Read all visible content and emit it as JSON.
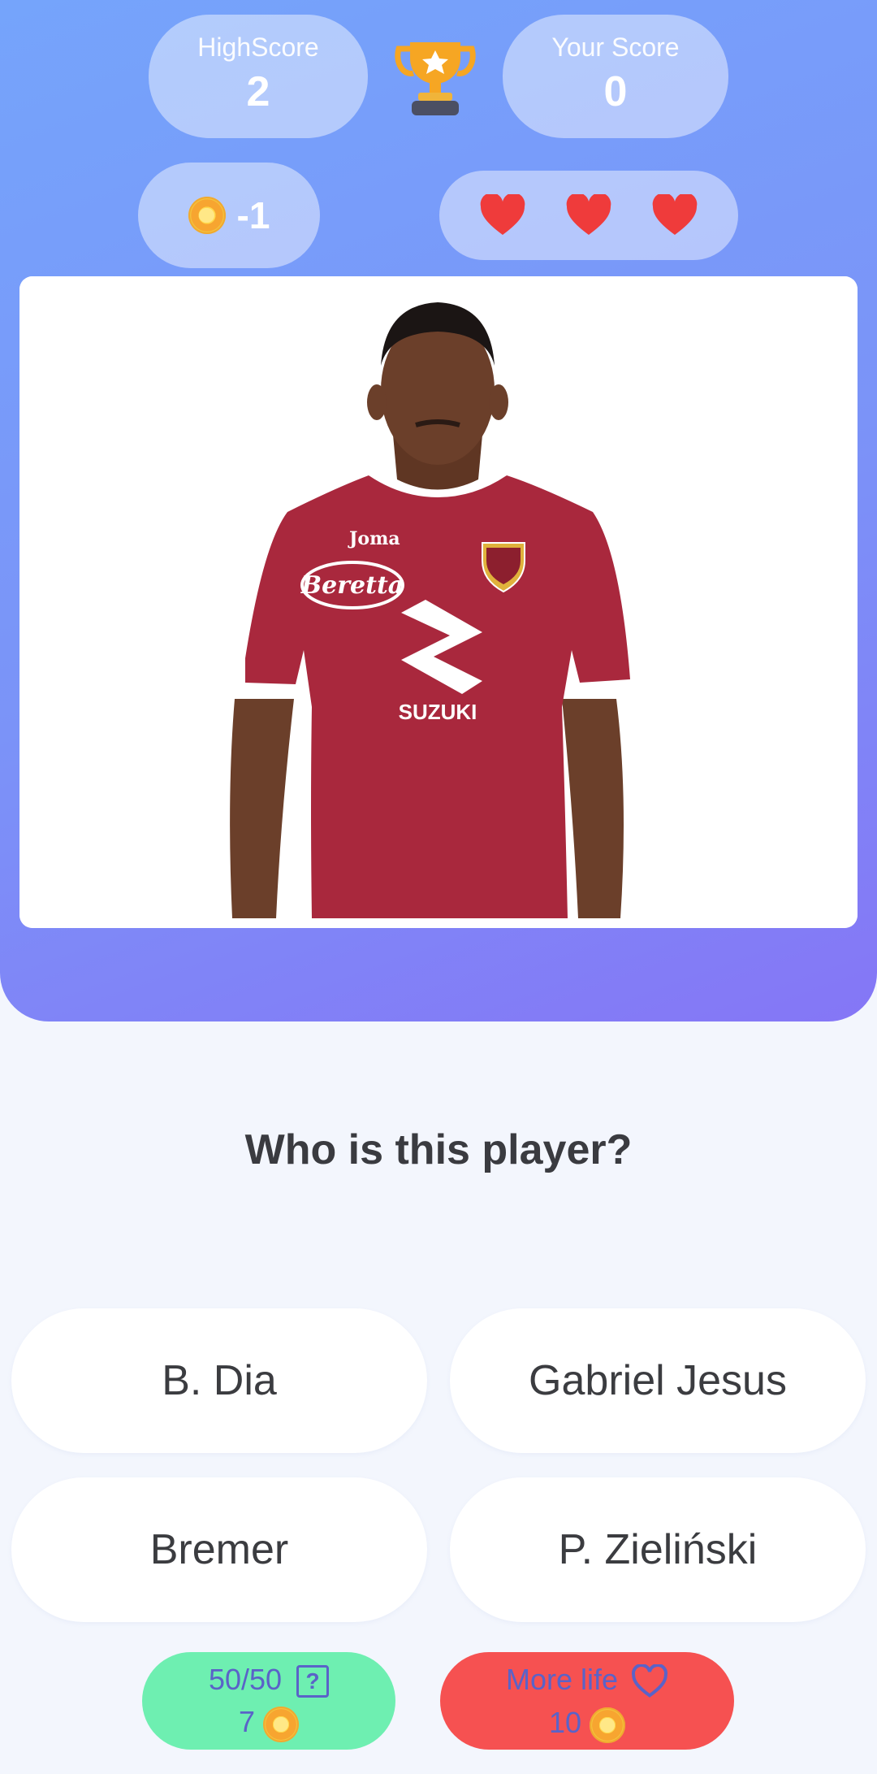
{
  "scoreboard": {
    "highscore_label": "HighScore",
    "highscore_value": "2",
    "your_score_label": "Your Score",
    "your_score_value": "0",
    "coins": "-1",
    "lives": 3
  },
  "photo": {
    "brand_kit": "Joma",
    "sponsor_chest": "SUZUKI",
    "sponsor_left": "Beretta"
  },
  "question": "Who is this player?",
  "answers": [
    "B. Dia",
    "Gabriel Jesus",
    "Bremer",
    "P. Zieliński"
  ],
  "powerups": {
    "fifty": {
      "label": "50/50",
      "cost": "7"
    },
    "life": {
      "label": "More life",
      "cost": "10"
    }
  },
  "colors": {
    "header_top": "#75a4fb",
    "header_bottom": "#8576f6",
    "heart": "#ef3b3b",
    "fifty_bg": "#6eefb1",
    "life_bg": "#f65151",
    "jersey": "#a9283d"
  }
}
